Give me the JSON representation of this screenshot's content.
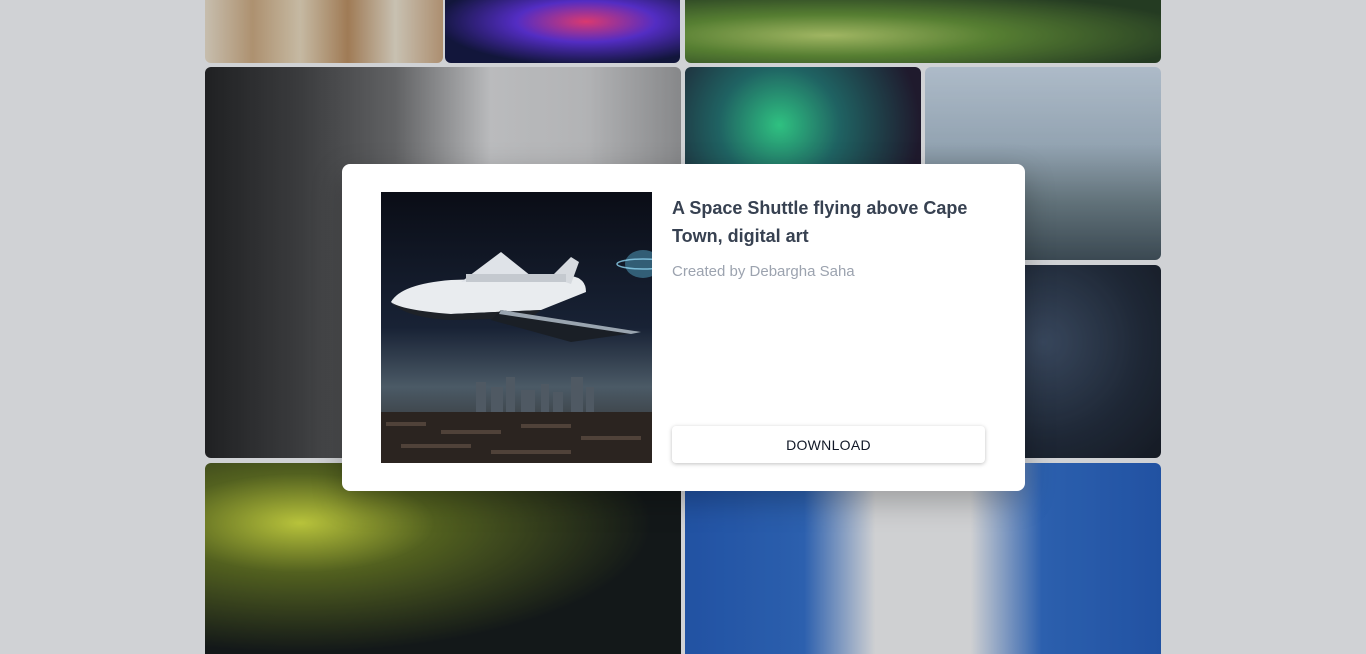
{
  "modal": {
    "title": "A Space Shuttle flying above Cape Town, digital art",
    "author": "Created by Debargha Saha",
    "download_label": "DOWNLOAD",
    "image_alt": "Space shuttle over a city skyline"
  },
  "colors": {
    "title": "#374151",
    "author": "#9ca3af",
    "modal_bg": "#ffffff",
    "page_bg": "#f3f4f6"
  }
}
